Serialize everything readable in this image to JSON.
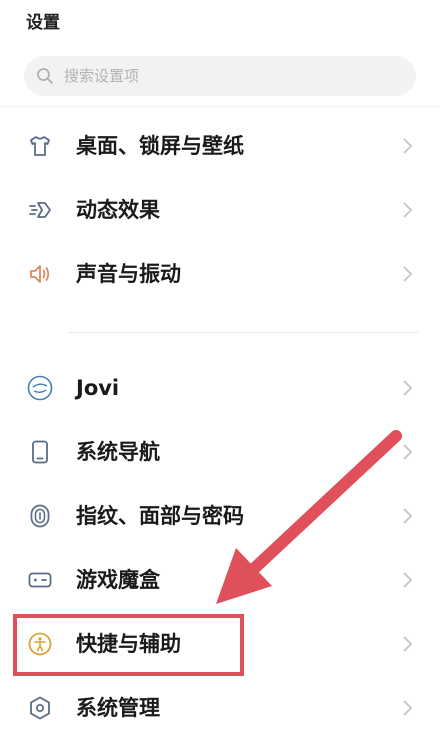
{
  "header": {
    "title": "设置"
  },
  "search": {
    "placeholder": "搜索设置项"
  },
  "items": [
    {
      "label": "桌面、锁屏与壁纸",
      "icon": "tshirt-icon",
      "color": "#5a6b86"
    },
    {
      "label": "动态效果",
      "icon": "motion-effect-icon",
      "color": "#5a6b86"
    },
    {
      "label": "声音与振动",
      "icon": "speaker-icon",
      "color": "#d98a5f"
    },
    {
      "label": "Jovi",
      "icon": "jovi-icon",
      "color": "#4a7fb5"
    },
    {
      "label": "系统导航",
      "icon": "phone-icon",
      "color": "#5a6b86"
    },
    {
      "label": "指纹、面部与密码",
      "icon": "fingerprint-icon",
      "color": "#5a6b86"
    },
    {
      "label": "游戏魔盒",
      "icon": "gamepad-icon",
      "color": "#5a6b86"
    },
    {
      "label": "快捷与辅助",
      "icon": "accessibility-icon",
      "color": "#d9a23a"
    },
    {
      "label": "系统管理",
      "icon": "hexagon-icon",
      "color": "#5a6b86"
    }
  ],
  "annotation": {
    "color": "#e0505b"
  }
}
